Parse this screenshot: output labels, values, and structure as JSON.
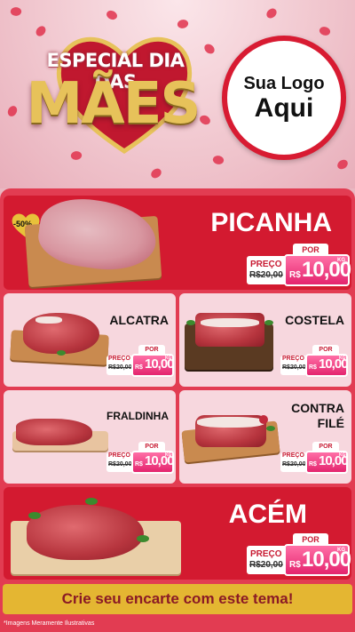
{
  "header": {
    "title_line1": "ESPECIAL DIA DAS",
    "title_line2": "MÃES",
    "logo_line1": "Sua Logo",
    "logo_line2": "Aqui"
  },
  "products": [
    {
      "name": "PICANHA",
      "badge": "-50%",
      "preco_label": "PREÇO",
      "old_price": "R$20,00",
      "por_label": "POR",
      "currency": "R$",
      "price": "10,00",
      "unit": "KG"
    },
    {
      "name": "ALCATRA",
      "preco_label": "PREÇO",
      "old_price": "R$20,00",
      "por_label": "POR",
      "currency": "R$",
      "price": "10,00",
      "unit": "KG"
    },
    {
      "name": "COSTELA",
      "preco_label": "PREÇO",
      "old_price": "R$20,00",
      "por_label": "POR",
      "currency": "R$",
      "price": "10,00",
      "unit": "KG"
    },
    {
      "name": "FRALDINHA",
      "preco_label": "PREÇO",
      "old_price": "R$20,00",
      "por_label": "POR",
      "currency": "R$",
      "price": "10,00",
      "unit": "KG"
    },
    {
      "name_line1": "CONTRA",
      "name_line2": "FILÉ",
      "preco_label": "PREÇO",
      "old_price": "R$20,00",
      "por_label": "POR",
      "currency": "R$",
      "price": "10,00",
      "unit": "KG"
    },
    {
      "name": "ACÉM",
      "preco_label": "PREÇO",
      "old_price": "R$20,00",
      "por_label": "POR",
      "currency": "R$",
      "price": "10,00",
      "unit": "KG"
    }
  ],
  "cta": "Crie seu encarte com este tema!",
  "footnote": "*Imagens Meramente Ilustrativas",
  "colors": {
    "panel": "#e23c52",
    "card_red": "#d31a30",
    "card_pink": "#f7d7de",
    "price_pink": "#e4246e",
    "cta_yellow": "#e4b632",
    "gold": "#e7c25a"
  }
}
